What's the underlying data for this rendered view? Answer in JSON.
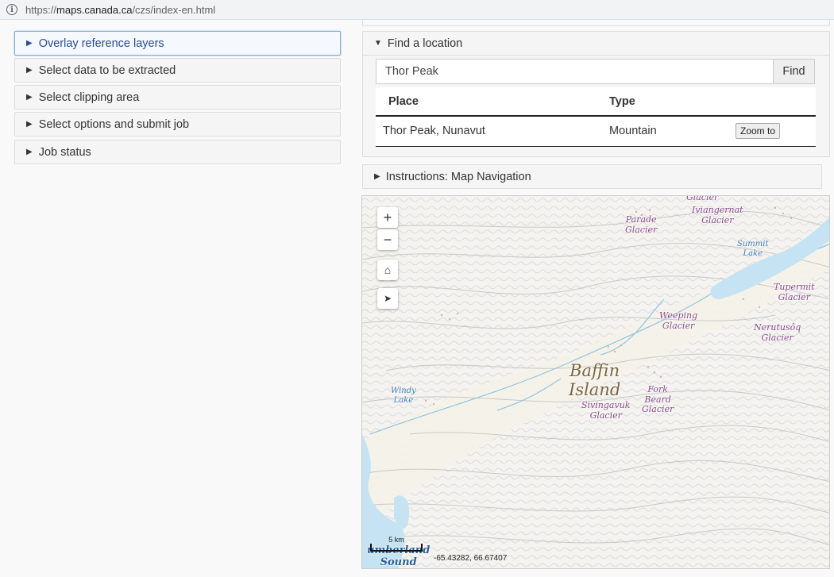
{
  "browser": {
    "url_prefix": "https://",
    "url_host": "maps.canada.ca",
    "url_path": "/czs/index-en.html"
  },
  "accordion": [
    {
      "label": "Overlay reference layers"
    },
    {
      "label": "Select data to be extracted"
    },
    {
      "label": "Select clipping area"
    },
    {
      "label": "Select options and submit job"
    },
    {
      "label": "Job status"
    }
  ],
  "find": {
    "title": "Find a location",
    "input_value": "Thor Peak",
    "button": "Find",
    "headers": {
      "place": "Place",
      "type": "Type"
    },
    "rows": [
      {
        "place": "Thor Peak, Nunavut",
        "type": "Mountain",
        "action": "Zoom to"
      }
    ]
  },
  "instructions": {
    "label": "Instructions: Map Navigation"
  },
  "map": {
    "controls": {
      "zoom_in": "+",
      "zoom_out": "−"
    },
    "labels": {
      "glacier_top": "Glacier",
      "iviangernat": "Iviangernat\nGlacier",
      "parade": "Parade\nGlacier",
      "summit_lake": "Summit\nLake",
      "tupermit": "Tupermit\nGlacier",
      "weeping": "Weeping\nGlacier",
      "nerutusoq": "Nerutusôq\nGlacier",
      "baffin": "Baffin\nIsland",
      "fork_beard": "Fork\nBeard\nGlacier",
      "sivingavuk": "Sivingavuk\nGlacier",
      "windy_lake": "Windy\nLake",
      "sound": "umberland\nSound"
    },
    "scale_label": "5 km",
    "coordinates": "-65.43282, 66.67407",
    "colors": {
      "water": "#c5e3f3",
      "glacier_label": "#8a4a8c",
      "contour": "#cfcfcf"
    }
  }
}
